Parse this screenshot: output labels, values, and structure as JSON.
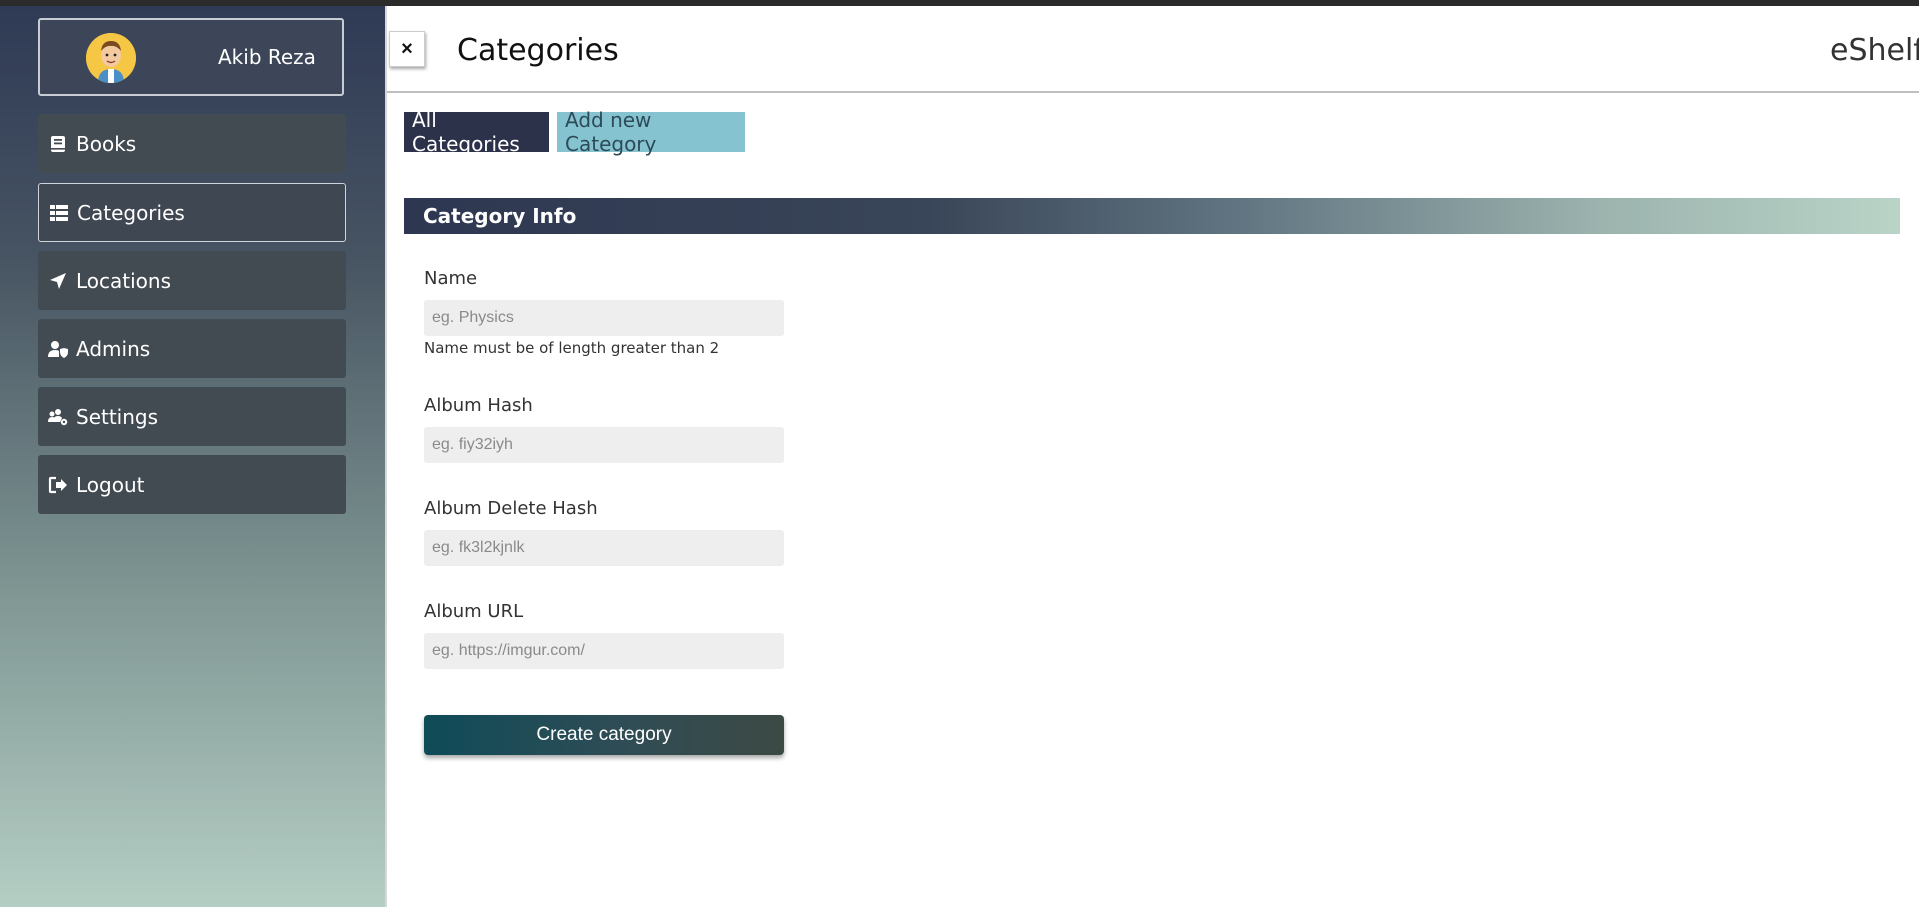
{
  "user": {
    "name": "Akib Reza"
  },
  "sidebar": {
    "items": [
      {
        "label": "Books",
        "icon": "book-icon"
      },
      {
        "label": "Categories",
        "icon": "list-icon",
        "active": true
      },
      {
        "label": "Locations",
        "icon": "location-arrow-icon"
      },
      {
        "label": "Admins",
        "icon": "user-shield-icon"
      },
      {
        "label": "Settings",
        "icon": "users-cog-icon"
      },
      {
        "label": "Logout",
        "icon": "sign-out-icon"
      }
    ]
  },
  "header": {
    "close_label": "×",
    "title": "Categories",
    "brand": "eShelf"
  },
  "tabs": [
    {
      "label": "All Categories",
      "active": true
    },
    {
      "label": "Add new Category"
    }
  ],
  "section": {
    "title": "Category Info"
  },
  "form": {
    "name": {
      "label": "Name",
      "placeholder": "eg. Physics",
      "value": "",
      "helper": "Name must be of length greater than 2"
    },
    "album_hash": {
      "label": "Album Hash",
      "placeholder": "eg. fiy32iyh",
      "value": ""
    },
    "album_delete_hash": {
      "label": "Album Delete Hash",
      "placeholder": "eg. fk3l2kjnlk",
      "value": ""
    },
    "album_url": {
      "label": "Album URL",
      "placeholder": "eg. https://imgur.com/",
      "value": ""
    },
    "submit_label": "Create category"
  },
  "colors": {
    "tab_active": "#2c3249",
    "tab_inactive": "#86c3d1",
    "input_bg": "#eeeeee"
  }
}
